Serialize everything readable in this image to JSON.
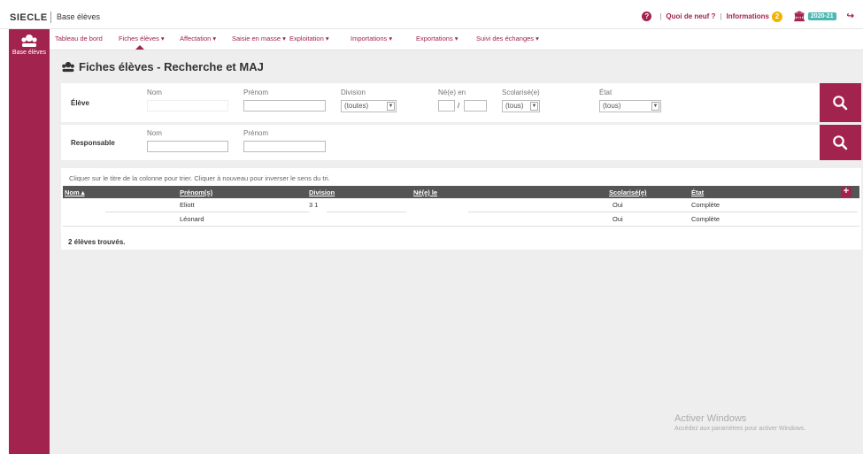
{
  "header": {
    "brand": "SIECLE",
    "app_name": "Base élèves",
    "help": "?",
    "whats_new": "Quoi de neuf ?",
    "separator": "|",
    "informations": "Informations",
    "info_count": "2",
    "year": "2020-21"
  },
  "sidebar": {
    "label": "Base élèves"
  },
  "nav": {
    "items": [
      "Tableau de bord",
      "Fiches élèves ▾",
      "Affectation ▾",
      "Saisie en masse ▾",
      "Exploitation ▾",
      "Importations ▾",
      "Exportations ▾",
      "Suivi des échanges ▾"
    ],
    "active_index": 1
  },
  "page": {
    "title": "Fiches élèves - Recherche et MAJ"
  },
  "eleve_panel": {
    "label": "Élève",
    "nom_label": "Nom",
    "prenom_label": "Prénom",
    "division_label": "Division",
    "division_value": "(toutes)",
    "ne_label": "Né(e) en",
    "slash": "/",
    "scolarise_label": "Scolarisé(e)",
    "scolarise_value": "(tous)",
    "etat_label": "État",
    "etat_value": "(tous)"
  },
  "responsable_panel": {
    "label": "Responsable",
    "nom_label": "Nom",
    "prenom_label": "Prénom"
  },
  "results": {
    "hint": "Cliquer sur le titre de la colonne pour trier. Cliquer à nouveau pour inverser le sens du tri.",
    "columns": [
      "Nom ▴",
      "Prénom(s)",
      "Division",
      "Né(e) le",
      "Scolarisé(e)",
      "État"
    ],
    "add_label": "+",
    "rows": [
      {
        "nom": "",
        "prenom": "Eliott",
        "division": "3 1",
        "ne": "",
        "scolarise": "Oui",
        "etat": "Complète"
      },
      {
        "nom": "",
        "prenom": "Léonard",
        "division": "",
        "ne": "",
        "scolarise": "Oui",
        "etat": "Complète"
      }
    ],
    "count": "2 élèves trouvés."
  },
  "watermark": {
    "line1": "Activer Windows",
    "line2": "Accédez aux paramètres pour activer Windows."
  },
  "colors": {
    "accent": "#a3234f",
    "badge": "#f0b400",
    "year_badge": "#4bb7b1",
    "table_header": "#555555"
  }
}
